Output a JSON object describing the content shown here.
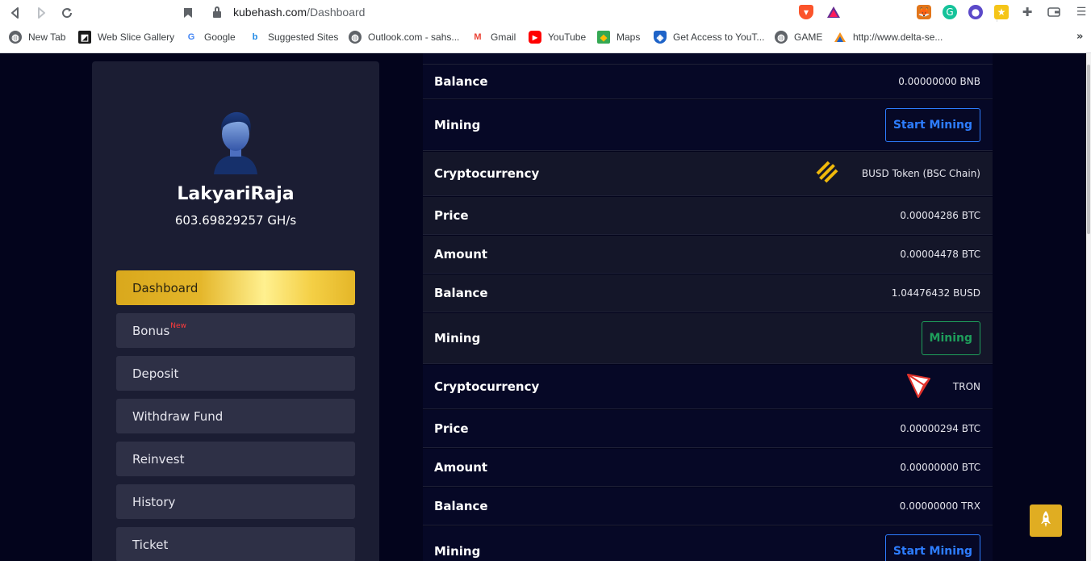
{
  "browser": {
    "url_domain": "kubehash.com",
    "url_path": "/Dashboard",
    "bookmarks": [
      {
        "label": "New Tab",
        "icon": "globe-icon"
      },
      {
        "label": "Web Slice Gallery",
        "icon": "web-slice-icon"
      },
      {
        "label": "Google",
        "icon": "google-icon"
      },
      {
        "label": "Suggested Sites",
        "icon": "bing-icon"
      },
      {
        "label": "Outlook.com - sahs...",
        "icon": "globe-icon"
      },
      {
        "label": "Gmail",
        "icon": "gmail-icon"
      },
      {
        "label": "YouTube",
        "icon": "youtube-icon"
      },
      {
        "label": "Maps",
        "icon": "maps-icon"
      },
      {
        "label": "Get Access to YouT...",
        "icon": "shield-icon"
      },
      {
        "label": "GAME",
        "icon": "globe-icon"
      },
      {
        "label": "http://www.delta-se...",
        "icon": "delta-icon"
      }
    ],
    "more_bookmarks": "»"
  },
  "sidebar": {
    "username": "LakyariRaja",
    "hashrate": "603.69829257 GH/s",
    "menu": [
      {
        "label": "Dashboard",
        "active": true,
        "badge": ""
      },
      {
        "label": "Bonus",
        "active": false,
        "badge": "New"
      },
      {
        "label": "Deposit",
        "active": false,
        "badge": ""
      },
      {
        "label": "Withdraw Fund",
        "active": false,
        "badge": ""
      },
      {
        "label": "Reinvest",
        "active": false,
        "badge": ""
      },
      {
        "label": "History",
        "active": false,
        "badge": ""
      },
      {
        "label": "Ticket",
        "active": false,
        "badge": ""
      }
    ]
  },
  "rows": {
    "r0": {
      "label": "Balance",
      "value": "0.00000000 BNB"
    },
    "r1": {
      "label": "Mining",
      "button": "Start Mining"
    },
    "r2": {
      "label": "Cryptocurrency",
      "value": "BUSD Token (BSC Chain)",
      "icon": "binance-icon"
    },
    "r3": {
      "label": "Price",
      "value": "0.00004286 BTC"
    },
    "r4": {
      "label": "Amount",
      "value": "0.00004478 BTC"
    },
    "r5": {
      "label": "Balance",
      "value": "1.04476432 BUSD"
    },
    "r6": {
      "label": "Mining",
      "button": "Mining"
    },
    "r7": {
      "label": "Cryptocurrency",
      "value": "TRON",
      "icon": "tron-icon"
    },
    "r8": {
      "label": "Price",
      "value": "0.00000294 BTC"
    },
    "r9": {
      "label": "Amount",
      "value": "0.00000000 BTC"
    },
    "r10": {
      "label": "Balance",
      "value": "0.00000000 TRX"
    },
    "r11": {
      "label": "Mining",
      "button": "Start Mining"
    }
  },
  "colors": {
    "background": "#03041c",
    "sidebar": "#1b1d33",
    "accent_gold": "#e0ad22",
    "start_mining_blue": "#2d7dff",
    "mining_green": "#1e9e5b",
    "new_badge_red": "#ff3b3b"
  }
}
